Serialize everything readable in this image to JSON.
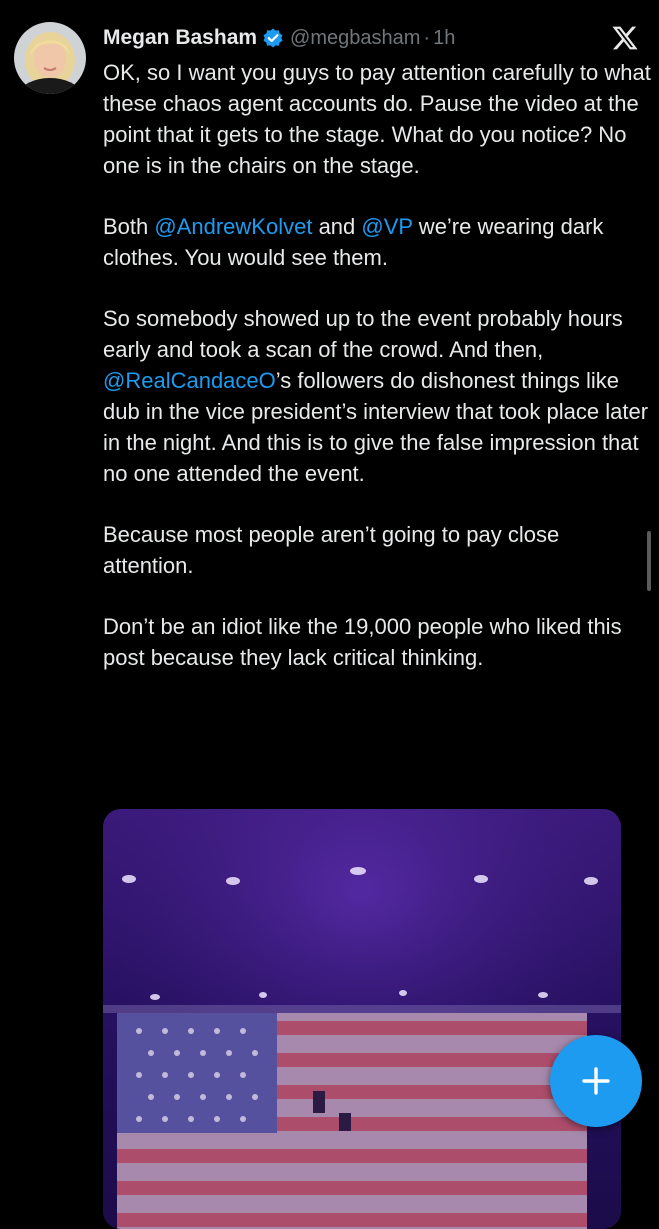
{
  "post": {
    "author_name": "Megan Basham",
    "handle": "@megbasham",
    "separator": "·",
    "time": "1h",
    "paragraphs": {
      "p1": "OK, so I want you guys to pay attention carefully to what these chaos agent accounts do. Pause the video at the point that it gets to the stage. What do you notice? No one is in the chairs on the stage.",
      "p2": {
        "t1": "Both ",
        "m1": "@AndrewKolvet",
        "t2": " and ",
        "m2": "@VP",
        "t3": " we’re wearing dark clothes. You would see them."
      },
      "p3": {
        "t1": "So somebody showed up to the event probably hours early and took a scan of the crowd. And then, ",
        "m1": "@RealCandaceO",
        "t2": "’s followers do dishonest things like dub in the vice president’s interview that took place later in the night. And this is to give the false impression that no one attended the event."
      },
      "p4": "Because most people aren’t going to pay close attention.",
      "p5": "Don’t be an idiot like the 19,000 people who liked this post because they lack critical thinking."
    }
  },
  "icons": {
    "verified": "verified-badge-icon",
    "close": "x-logo-icon",
    "compose": "plus-icon"
  },
  "colors": {
    "background": "#000000",
    "text": "#e7e9ea",
    "secondary_text": "#71767b",
    "accent": "#1d9bf0"
  }
}
